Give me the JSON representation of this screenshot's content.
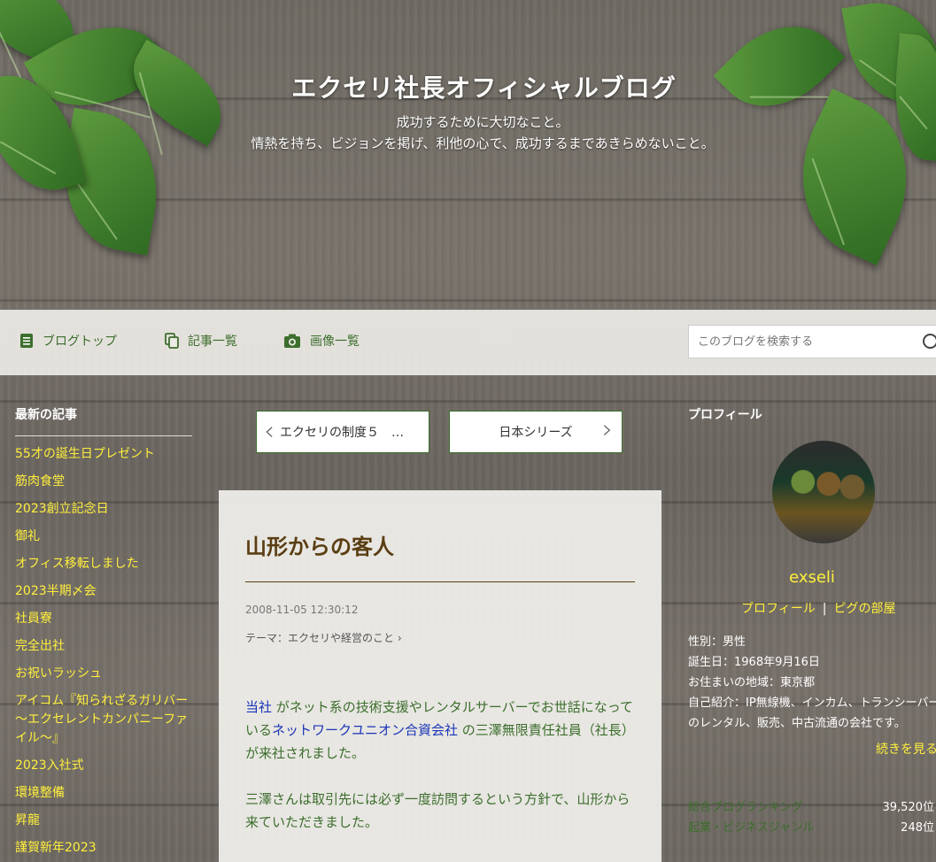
{
  "header": {
    "title": "エクセリ社長オフィシャルブログ",
    "description_line1": "成功するために大切なこと。",
    "description_line2": "情熱を持ち、ビジョンを掲げ、利他の心で、成功するまであきらめないこと。"
  },
  "nav": {
    "items": [
      {
        "label": "ブログトップ",
        "icon": "document-icon"
      },
      {
        "label": "記事一覧",
        "icon": "copy-icon"
      },
      {
        "label": "画像一覧",
        "icon": "camera-icon"
      }
    ],
    "search_placeholder": "このブログを検索する"
  },
  "sidebar_left": {
    "heading": "最新の記事",
    "items": [
      "55才の誕生日プレゼント",
      "筋肉食堂",
      "2023創立記念日",
      "御礼",
      "オフィス移転しました",
      "2023半期〆会",
      "社員寮",
      "完全出社",
      "お祝いラッシュ",
      "アイコム『知られざるガリバー～エクセレントカンパニーファイル～』",
      "2023入社式",
      "環境整備",
      "昇龍",
      "謹賀新年2023"
    ]
  },
  "pager": {
    "prev_label": "エクセリの制度５　…",
    "next_label": "日本シリーズ"
  },
  "article": {
    "title": "山形からの客人",
    "date": "2008-11-05 12:30:12",
    "theme": "テーマ：エクセリや経営のこと",
    "p1_link1": "当社",
    "p1_text1": " がネット系の技術支援やレンタルサーバーでお世話になっている",
    "p1_link2": "ネットワークユニオン合資会社",
    "p1_text2": " の三澤無限責任社員（社長）が来社されました。",
    "p2": "三澤さんは取引先には必ず一度訪問するという方針で、山形から来ていただきました。"
  },
  "sidebar_right": {
    "heading": "プロフィール",
    "username": "exseli",
    "link_profile": "プロフィール",
    "link_pig": "ピグの部屋",
    "gender": "性別：男性",
    "birthday": "誕生日：1968年9月16日",
    "location": "お住まいの地域：東京都",
    "intro": "自己紹介：IP無線機、インカム、トランシーバーのレンタル、販売、中古流通の会社です。",
    "more": "続きを見る",
    "rank1_label": "総合ブログランキング",
    "rank1_value": "39,520位",
    "rank2_label": "起業・ビジネスジャンル",
    "rank2_value": "248位"
  },
  "colors": {
    "accent_green": "#3c6e2d",
    "link_yellow": "#ffef3c",
    "title_brown": "#5a3e12",
    "link_blue": "#1a35b8"
  }
}
